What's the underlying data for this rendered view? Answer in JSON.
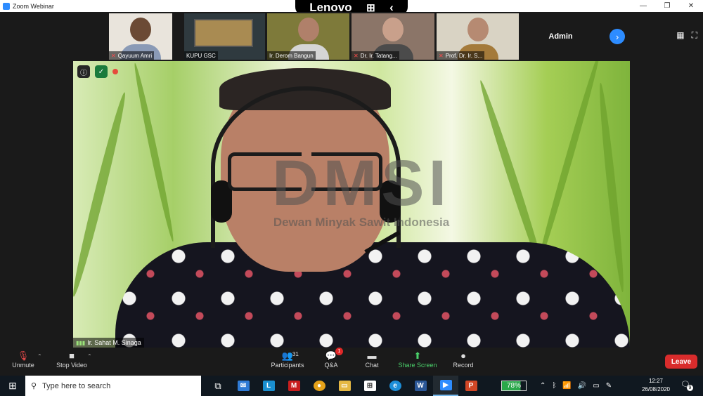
{
  "window": {
    "title": "Zoom Webinar",
    "controls": [
      "—",
      "❐",
      "✕"
    ]
  },
  "lenovo": {
    "brand": "Lenovo",
    "qr_glyph": "⊞",
    "back_glyph": "‹"
  },
  "gallery": {
    "tiles": [
      {
        "name": "Qayuum Amri"
      },
      {
        "name": "KUPU GSC"
      },
      {
        "name": "Ir. Derom Bangun"
      },
      {
        "name": "Dr. Ir. Tatang..."
      },
      {
        "name": "Prof. Dr. Ir. S..."
      }
    ],
    "admin_label": "Admin",
    "next_glyph": "›",
    "grid_glyph": "▦",
    "fullscreen_glyph": "⛶"
  },
  "stage": {
    "watermark_main": "DMSI",
    "watermark_sub": "Dewan Minyak Sawit Indonesia",
    "speaker": "Ir. Sahat M. Sinaga"
  },
  "toolbar": {
    "unmute": "Unmute",
    "stop_video": "Stop Video",
    "participants": "Participants",
    "participants_count": "31",
    "qa": "Q&A",
    "qa_badge": "1",
    "chat": "Chat",
    "share_screen": "Share Screen",
    "record": "Record",
    "leave": "Leave"
  },
  "taskbar": {
    "search_placeholder": "Type here to search",
    "battery": "78%",
    "battery_level": 0.78,
    "time": "12:27",
    "date": "26/08/2020",
    "notification_count": "9"
  },
  "colors": {
    "accent": "#2d8cff",
    "leave": "#d92c2c",
    "share": "#4bd26b",
    "muted": "#e04848"
  }
}
